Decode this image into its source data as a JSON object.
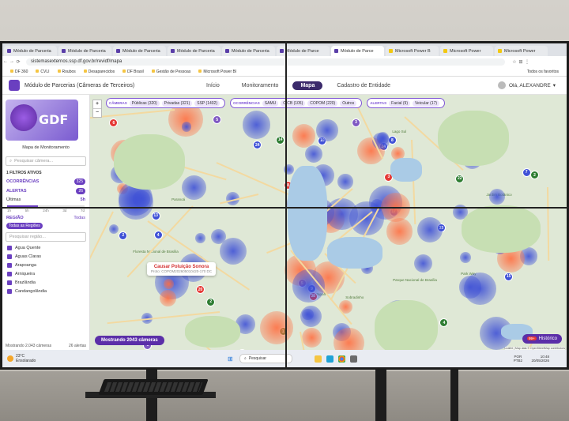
{
  "browser": {
    "tabs": [
      {
        "label": "Módulo de Parceria",
        "icon": "gdf-favicon"
      },
      {
        "label": "Módulo de Parceria",
        "icon": "gdf-favicon"
      },
      {
        "label": "Módulo de Parceria",
        "icon": "gdf-favicon"
      },
      {
        "label": "Módulo de Parceria",
        "icon": "gdf-favicon"
      },
      {
        "label": "Módulo de Parceria",
        "icon": "gdf-favicon"
      },
      {
        "label": "Módulo de Parce",
        "icon": "gdf-favicon"
      },
      {
        "label": "Módulo de Parce",
        "icon": "gdf-favicon"
      },
      {
        "label": "Microsoft Power B",
        "icon": "powerbi-favicon"
      },
      {
        "label": "Microsoft Power",
        "icon": "powerbi-favicon"
      },
      {
        "label": "Microsoft Power",
        "icon": "powerbi-favicon"
      }
    ],
    "active_tab": 6,
    "url": "sistemasexternos.ssp.df.gov.br/revidf/mapa",
    "bookmarks": [
      "DF 360",
      "CVLI",
      "Roubos",
      "Desaparecidos",
      "DF Brasil",
      "Gestão de Pessoas",
      "Microsoft Power BI"
    ],
    "all_bookmarks": "Todos os favoritos"
  },
  "header": {
    "title": "Módulo de Parcerias (Câmeras de Terceiros)",
    "menu": [
      "Início",
      "Monitoramento",
      "Mapa",
      "Cadastro de Entidade"
    ],
    "active_menu": "Mapa",
    "greeting": "Olá, ALEXANDRE"
  },
  "sidebar": {
    "logo_text": "GDF",
    "map_title": "Mapa de Monitoramento",
    "search_placeholder": "Pesquisar câmera...",
    "filters_active": "1 FILTROS ATIVOS",
    "occurrences_label": "OCORRÊNCIAS",
    "occurrences_count": "325",
    "alerts_label": "ALERTAS",
    "alerts_count": "26",
    "last_label": "Últimas",
    "last_value": "5h",
    "slider_ticks": [
      "1h",
      "5h",
      "24h",
      "3d",
      "7d"
    ],
    "slider_level_percent": 40,
    "region_label": "REGIÃO",
    "region_all": "Todas",
    "region_chip": "Todas as Regiões",
    "region_search_placeholder": "Pesquisar região...",
    "regions": [
      "Agua Quente",
      "Aguas Claras",
      "Arapoanga",
      "Arniqueira",
      "Brazlândia",
      "Candangolândia"
    ],
    "footer_showing": "Mostrando 2.043 câmeras",
    "footer_alerts": "26 alertas"
  },
  "map": {
    "filter_groups": [
      {
        "title": "CÂMERAS",
        "chips": [
          "Públicas (320)",
          "Privadas (321)",
          "SSP (1402)"
        ]
      },
      {
        "title": "OCORRÊNCIAS",
        "chips": [
          "SAMU",
          "CICB (105)",
          "COPOM (220)",
          "Outros"
        ]
      },
      {
        "title": "ALERTAS",
        "chips": [
          "Facial (9)",
          "Veicular (17)"
        ]
      }
    ],
    "zoom_in": "+",
    "zoom_out": "−",
    "popup_title": "Causar Poluição Sonora",
    "popup_sub": "Proto: COPOM202605010420-170 DC",
    "showing_button": "Mostrando 2043 câmeras",
    "history_badge": "99+",
    "history_button": "Histórico",
    "attribution": "Leaflet | Map data © OpenStreetMap contributors",
    "place_labels": [
      "Floresta Nacional de Brasília",
      "Parque Nacional de Brasília",
      "Jardim Botânico",
      "Park Way",
      "Lago Sul",
      "Paranoá",
      "Itapoã",
      "Sobradinho"
    ],
    "clusters": [
      "3",
      "24",
      "13",
      "18",
      "15",
      "33",
      "22",
      "16",
      "4",
      "2",
      "20",
      "38",
      "8",
      "9",
      "2",
      "3",
      "5",
      "6",
      "7",
      "1",
      "12",
      "51",
      "21",
      "8",
      "14",
      "5",
      "3",
      "2",
      "17",
      "13",
      "4",
      "6",
      "8",
      "9",
      "24",
      "10"
    ]
  },
  "taskbar": {
    "weather_temp": "23°C",
    "weather_desc": "Ensolarado",
    "search_placeholder": "Pesquisar",
    "lang": "POR",
    "lang_sub": "PTB2",
    "time": "10:48",
    "date": "20/05/2026"
  },
  "colors": {
    "accent": "#6a3fc0",
    "accent_dark": "#3b2a6b",
    "occurrence_red": "#e53935",
    "camera_blue": "#3f51d6",
    "orange_heat": "#ff7043"
  }
}
